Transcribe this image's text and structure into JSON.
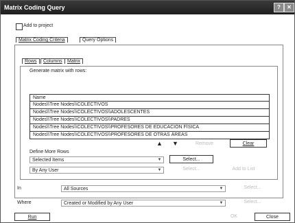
{
  "window": {
    "title": "Matrix Coding Query",
    "help_glyph": "?",
    "close_glyph": "✕"
  },
  "add_to_project": "Add to project",
  "tabs_main": [
    "Matrix Coding Criteria",
    "Query Options"
  ],
  "tabs_sub": [
    "Rows",
    "Columns",
    "Matrix"
  ],
  "generate_label": "Generate matrix with rows:",
  "grid": {
    "header": "Name",
    "rows": [
      "Nodes\\\\Tree Nodes\\\\COLECTIVOS",
      "Nodes\\\\Tree Nodes\\\\COLECTIVOS\\\\ADOLESCENTES",
      "Nodes\\\\Tree Nodes\\\\COLECTIVOS\\\\PADRES",
      "Nodes\\\\Tree Nodes\\\\COLECTIVOS\\\\PROFESORES DE EDUCACIÓN FÍSICA",
      "Nodes\\\\Tree Nodes\\\\COLECTIVOS\\\\PROFESORES DE OTRAS ÁREAS"
    ]
  },
  "order_buttons": {
    "up": "▲",
    "down": "▼",
    "remove": "Remove",
    "clear": "Clear"
  },
  "define_more_rows": "Define More Rows",
  "selected_items": "Selected Items",
  "select_label": "Select...",
  "by_any_user": "By Any User",
  "add_to_list": "Add to List",
  "in_label": "In",
  "in_value": "All Sources",
  "where_label": "Where",
  "where_value": "Created or Modified by Any User",
  "footer": {
    "run": "Run",
    "ok": "OK",
    "close": "Close"
  }
}
